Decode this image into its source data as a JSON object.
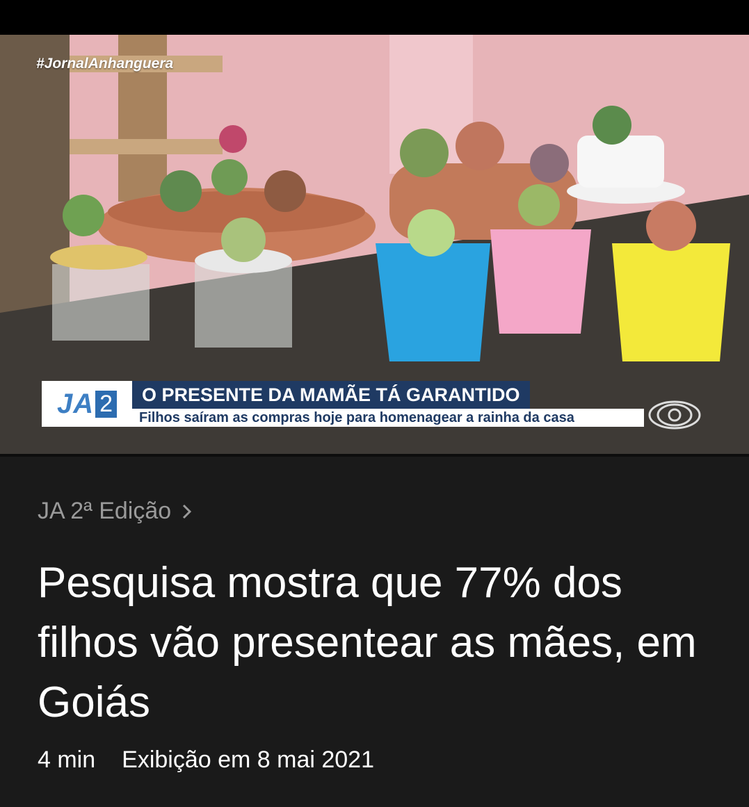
{
  "video": {
    "hashtag": "#JornalAnhanguera",
    "program_logo_text": "JA",
    "program_logo_number": "2",
    "headline_banner": "O PRESENTE DA MAMÃE TÁ GARANTIDO",
    "subtitle_banner": "Filhos saíram as compras hoje para homenagear a rainha da casa"
  },
  "article": {
    "category": "JA 2ª Edição",
    "category_icon": "chevron-right-icon",
    "title": "Pesquisa mostra que 77% dos filhos vão presentear as mães, em Goiás",
    "duration": "4 min",
    "aired": "Exibição em 8 mai 2021"
  },
  "colors": {
    "background": "#1a1a1a",
    "banner_blue": "#1f3a63",
    "logo_blue": "#3d7fc4"
  }
}
